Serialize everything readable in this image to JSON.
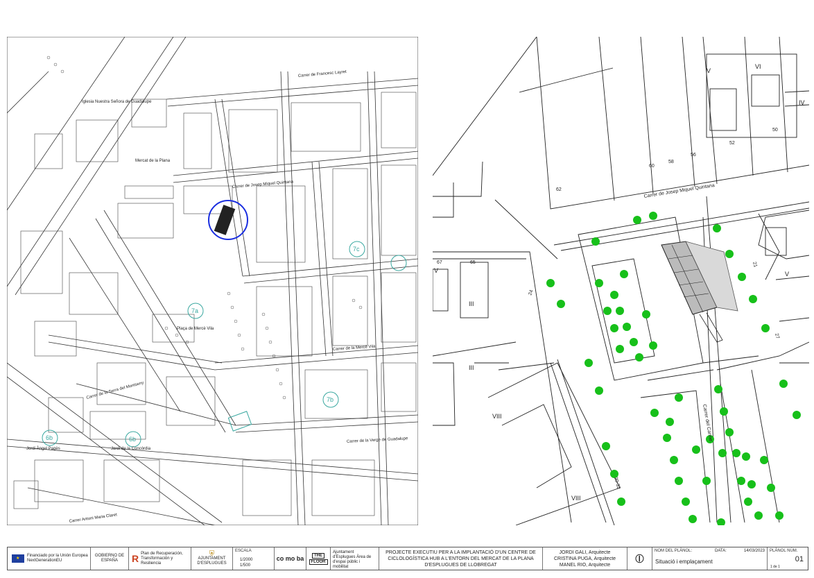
{
  "left_map": {
    "streets": {
      "francesc_layret": "Carrer de Francesc Layret",
      "miquel_quintana": "Carrer de Josep Miquel Quintana",
      "verge_guadalupe": "Carrer de la Verge de Guadalupe",
      "merce_vila": "Carrer de la Mercè Vila",
      "serra_montseny": "Carrer de la Serra del Montseny",
      "antoni_maria_claret": "Carrer Antoni Maria Claret"
    },
    "places": {
      "mercat_plana": "Mercat de la Plana",
      "placa_mercat": "Plaça de Mercè Vila",
      "jardi_concordia": "Jardí de la Concòrdia",
      "jordi_angel": "Jordi Àngel Pagès",
      "iglesia": "Iglesia Nuestra Señora de Guadalupe"
    },
    "markers": [
      "6b",
      "6b",
      "7a",
      "7b",
      "7c"
    ]
  },
  "right_map": {
    "street_label": "Carrer de Josep Miquel Quintana",
    "street_label_2": "Carrer del Carme",
    "parcel_numbers": [
      "62",
      "60",
      "58",
      "56",
      "52",
      "50",
      "67",
      "65",
      "24",
      "21",
      "27",
      "30-32"
    ],
    "roman_numerals": [
      "V",
      "VI",
      "IV",
      "V",
      "III",
      "III",
      "VIII",
      "VIII",
      "V"
    ]
  },
  "titleblock": {
    "funding_eu": "Financiado por la Unión Europea",
    "funding_eu_2": "NextGenerationEU",
    "gobierno": "GOBIERNO DE ESPAÑA",
    "plan": "Plan de Recuperación, Transformación y Resiliencia",
    "ajuntament_small": "AJUNTAMENT D'ESPLUGUES",
    "escala_label": "ESCALA",
    "escala_1": "1/2000",
    "escala_2": "1/500",
    "comoba": "co mo ba",
    "the_floor_1": "THE",
    "the_floor_2": "FLOOR",
    "ajuntament_area": "Ajuntament d'Esplugues Àrea de d'espai públic i mobilitat",
    "project_title": "PROJECTE EXECUTIU PER A LA IMPLANTACIÓ D'UN CENTRE DE CICLOLOGÍSTICA HUB A L'ENTORN DEL MERCAT DE LA PLANA D'ESPLUGUES DE LLOBREGAT",
    "architects": [
      "JORDI GALI, Arquitecte",
      "CRISTINA PUGA, Arquitecte",
      "MANEL RIO, Arquitecte"
    ],
    "nom_label": "NOM DEL PLÀNOL:",
    "nom_value": "Situació i emplaçament",
    "data_label": "DATA:",
    "data_value": "14/03/2023",
    "plan_num_label": "PLÀNOL NÚM.",
    "plan_num_value": "01",
    "sheet": "1 de 1"
  }
}
